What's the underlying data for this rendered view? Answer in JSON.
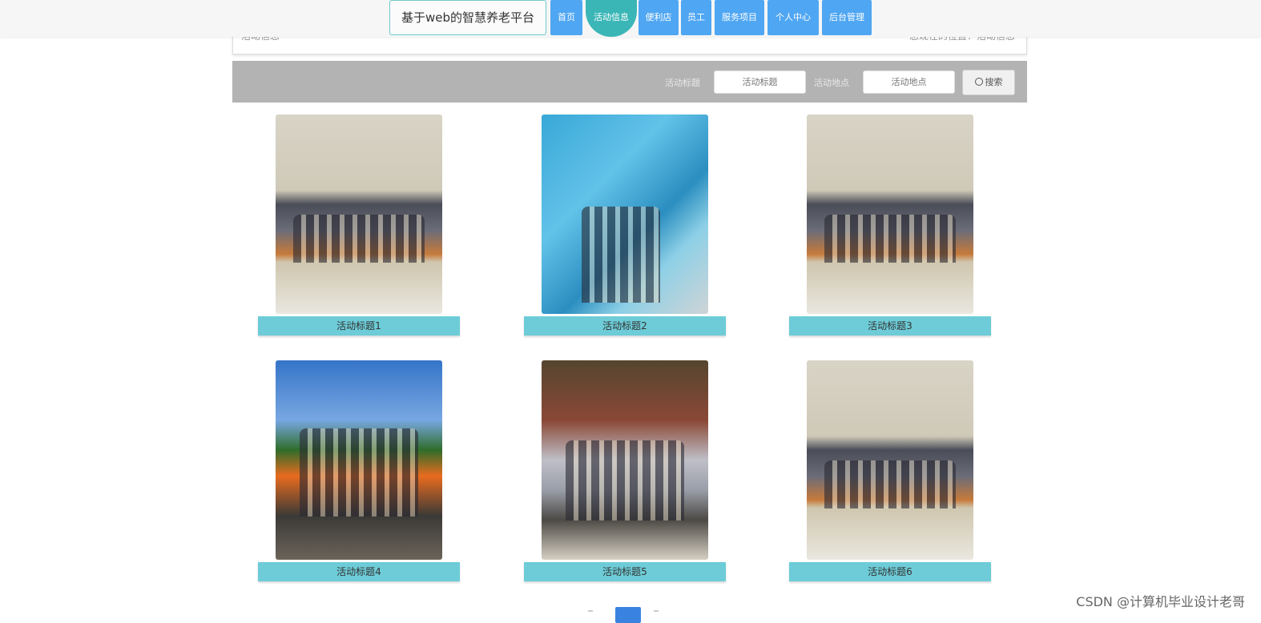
{
  "nav": {
    "brand": "基于web的智慧养老平台",
    "items": [
      {
        "label": "首页",
        "active": false
      },
      {
        "label": "活动信息",
        "active": true
      },
      {
        "label": "便利店",
        "active": false
      },
      {
        "label": "员工",
        "active": false
      },
      {
        "label": "服务项目",
        "active": false
      },
      {
        "label": "个人中心",
        "active": false
      },
      {
        "label": "后台管理",
        "active": false
      }
    ]
  },
  "breadcrumb": {
    "left": "活动信息",
    "right": "您现在的位置：活动信息"
  },
  "search": {
    "title_label": "活动标题",
    "title_placeholder": "活动标题",
    "place_label": "活动地点",
    "place_placeholder": "活动地点",
    "button_label": "搜索"
  },
  "cards": [
    {
      "title": "活动标题1",
      "scene": "hall"
    },
    {
      "title": "活动标题2",
      "scene": "stage"
    },
    {
      "title": "活动标题3",
      "scene": "hall"
    },
    {
      "title": "活动标题4",
      "scene": "outdoor"
    },
    {
      "title": "活动标题5",
      "scene": "temple"
    },
    {
      "title": "活动标题6",
      "scene": "hall"
    }
  ],
  "pagination": {
    "current": 1
  },
  "watermark": "CSDN @计算机毕业设计老哥",
  "colors": {
    "nav_blue": "#4fa6f2",
    "nav_active": "#3bb6b7",
    "caption_bg": "#6dccd7",
    "searchbar_bg": "#b3b3b3"
  }
}
